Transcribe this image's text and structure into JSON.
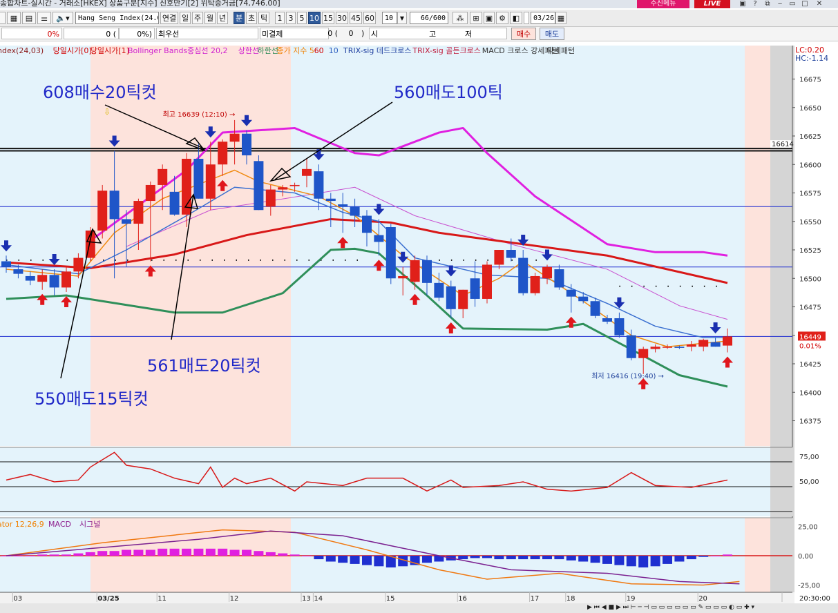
{
  "window": {
    "title_fragment": "종합차트-실시간 - 거래소[HKEX] 상품구분[지수] 신호만기[2] 위탁증거금[74,746.00]",
    "ad_badge": "수신메뉴",
    "live_badge": "LIVE"
  },
  "toolbar": {
    "symbol": "Hang Seng Index(24.0",
    "period_buttons": [
      "연결",
      "일",
      "주",
      "월",
      "년",
      "분",
      "초",
      "틱"
    ],
    "active_period": "분",
    "interval_buttons": [
      "1",
      "3",
      "5",
      "10",
      "15",
      "30",
      "45",
      "60"
    ],
    "active_interval": "10",
    "interval_select": "10",
    "bar_count": "66/600",
    "date_value": "03/26"
  },
  "info": {
    "change_pct": "0%",
    "vol": "0 (",
    "vol_pct": "0%)",
    "best_ask_label": "최우선",
    "oi_label": "미결제",
    "oi_value": "0 (",
    "oi_change": "0",
    "oi_close": ")",
    "ohlc_labels": [
      "시",
      "고",
      "저"
    ],
    "buy_btn": "매수",
    "sell_btn": "매도"
  },
  "legend": [
    {
      "text": "ndex(24,03)",
      "color": "#8b1a1a"
    },
    {
      "text": "당일시가[0]",
      "color": "#d10000"
    },
    {
      "text": "당일시가[1]",
      "color": "#d10000"
    },
    {
      "text": "Bollinger Bands중심선 20,2",
      "color": "#d020d0"
    },
    {
      "text": "상한선",
      "color": "#d020d0"
    },
    {
      "text": "하한선",
      "color": "#2e8b57"
    },
    {
      "text": "종가 지수 5",
      "color": "#f08000"
    },
    {
      "text": "60",
      "color": "#d10000"
    },
    {
      "text": "10",
      "color": "#3060c0"
    },
    {
      "text": "TRIX-sig 데드크로스",
      "color": "#2040a0"
    },
    {
      "text": "TRIX-sig 골든크로스",
      "color": "#c02040"
    },
    {
      "text": "MACD 크로스 강세패턴",
      "color": "#333333"
    },
    {
      "text": "약세패턴",
      "color": "#333333"
    }
  ],
  "right_corner": {
    "lc": "LC:0.20",
    "hc": "HC:-1.14"
  },
  "colors": {
    "up": "#e0201a",
    "down": "#1f55c8",
    "bb_band": "#e020e0",
    "bb_lower": "#2f8f5a",
    "ma60": "#d81818",
    "ma10": "#3a6fd0",
    "ema5": "#f08a10",
    "session_bg": "#fde3dc",
    "chart_bg": "#e4f3fb"
  },
  "chart_data": {
    "type": "candlestick",
    "symbol": "Hang Seng Index",
    "ylim": [
      16365,
      16685
    ],
    "y_ticks": [
      16675,
      16650,
      16625,
      16600,
      16575,
      16550,
      16525,
      16500,
      16475,
      16450,
      16425,
      16400,
      16375
    ],
    "x_labels": [
      {
        "bar": 1,
        "label": "03"
      },
      {
        "bar": 8,
        "label": "03/25"
      },
      {
        "bar": 13,
        "label": "11"
      },
      {
        "bar": 19,
        "label": "12"
      },
      {
        "bar": 25,
        "label": "13"
      },
      {
        "bar": 26,
        "label": "14"
      },
      {
        "bar": 32,
        "label": "15"
      },
      {
        "bar": 38,
        "label": "16"
      },
      {
        "bar": 44,
        "label": "17"
      },
      {
        "bar": 47,
        "label": "18"
      },
      {
        "bar": 52,
        "label": "19"
      },
      {
        "bar": 58,
        "label": "20"
      },
      {
        "bar": 65,
        "label": "20:30:00"
      }
    ],
    "candles": [
      [
        16515,
        16520,
        16505,
        16510
      ],
      [
        16508,
        16512,
        16500,
        16504
      ],
      [
        16502,
        16506,
        16494,
        16498
      ],
      [
        16497,
        16508,
        16490,
        16503
      ],
      [
        16503,
        16508,
        16485,
        16492
      ],
      [
        16492,
        16510,
        16488,
        16506
      ],
      [
        16506,
        16522,
        16500,
        16518
      ],
      [
        16518,
        16545,
        16515,
        16542
      ],
      [
        16542,
        16582,
        16535,
        16577
      ],
      [
        16577,
        16612,
        16500,
        16552
      ],
      [
        16552,
        16560,
        16510,
        16548
      ],
      [
        16548,
        16570,
        16525,
        16568
      ],
      [
        16568,
        16585,
        16515,
        16582
      ],
      [
        16582,
        16600,
        16560,
        16596
      ],
      [
        16576,
        16590,
        16555,
        16556
      ],
      [
        16556,
        16610,
        16545,
        16605
      ],
      [
        16605,
        16618,
        16570,
        16570
      ],
      [
        16570,
        16620,
        16560,
        16600
      ],
      [
        16600,
        16622,
        16590,
        16620
      ],
      [
        16620,
        16639,
        16600,
        16627
      ],
      [
        16627,
        16630,
        16600,
        16608
      ],
      [
        16603,
        16608,
        16560,
        16560
      ],
      [
        16563,
        16582,
        16555,
        16578
      ],
      [
        16578,
        16582,
        16572,
        16580
      ],
      [
        16581,
        16584,
        16576,
        16582
      ],
      [
        16590,
        16605,
        16580,
        16596
      ],
      [
        16594,
        16600,
        16560,
        16570
      ],
      [
        16570,
        16575,
        16545,
        16568
      ],
      [
        16565,
        16575,
        16540,
        16563
      ],
      [
        16563,
        16570,
        16545,
        16555
      ],
      [
        16555,
        16560,
        16528,
        16540
      ],
      [
        16538,
        16552,
        16520,
        16532
      ],
      [
        16545,
        16548,
        16495,
        16500
      ],
      [
        16500,
        16510,
        16485,
        16502
      ],
      [
        16497,
        16520,
        16490,
        16516
      ],
      [
        16516,
        16520,
        16485,
        16496
      ],
      [
        16496,
        16505,
        16480,
        16483
      ],
      [
        16493,
        16498,
        16465,
        16473
      ],
      [
        16473,
        16490,
        16465,
        16490
      ],
      [
        16500,
        16515,
        16475,
        16482
      ],
      [
        16482,
        16515,
        16478,
        16512
      ],
      [
        16512,
        16525,
        16508,
        16525
      ],
      [
        16525,
        16535,
        16515,
        16518
      ],
      [
        16518,
        16525,
        16485,
        16487
      ],
      [
        16487,
        16505,
        16485,
        16502
      ],
      [
        16500,
        16512,
        16495,
        16510
      ],
      [
        16508,
        16512,
        16490,
        16492
      ],
      [
        16490,
        16495,
        16470,
        16484
      ],
      [
        16484,
        16488,
        16478,
        16480
      ],
      [
        16480,
        16483,
        16465,
        16467
      ],
      [
        16465,
        16468,
        16460,
        16462
      ],
      [
        16465,
        16470,
        16448,
        16450
      ],
      [
        16450,
        16455,
        16428,
        16430
      ],
      [
        16430,
        16440,
        16416,
        16438
      ],
      [
        16438,
        16442,
        16435,
        16440
      ],
      [
        16440,
        16442,
        16438,
        16440
      ],
      [
        16440,
        16441,
        16438,
        16439
      ],
      [
        16440,
        16445,
        16436,
        16442
      ],
      [
        16440,
        16447,
        16436,
        16446
      ],
      [
        16444,
        16448,
        16440,
        16440
      ],
      [
        16441,
        16456,
        16435,
        16449
      ]
    ],
    "bb_upper": [
      [
        7,
        16533
      ],
      [
        15,
        16595
      ],
      [
        18,
        16628
      ],
      [
        24,
        16632
      ],
      [
        29,
        16610
      ],
      [
        31,
        16608
      ],
      [
        36,
        16628
      ],
      [
        38,
        16632
      ],
      [
        40,
        16610
      ],
      [
        44,
        16572
      ],
      [
        50,
        16530
      ],
      [
        54,
        16523
      ],
      [
        58,
        16523
      ],
      [
        60,
        16520
      ]
    ],
    "bb_lower": [
      [
        0,
        16482
      ],
      [
        5,
        16485
      ],
      [
        8,
        16480
      ],
      [
        14,
        16470
      ],
      [
        18,
        16470
      ],
      [
        23,
        16487
      ],
      [
        27,
        16525
      ],
      [
        29,
        16526
      ],
      [
        31,
        16522
      ],
      [
        35,
        16485
      ],
      [
        38,
        16456
      ],
      [
        45,
        16455
      ],
      [
        48,
        16460
      ],
      [
        53,
        16432
      ],
      [
        56,
        16415
      ],
      [
        60,
        16405
      ]
    ],
    "ma60": [
      [
        0,
        16514
      ],
      [
        7,
        16509
      ],
      [
        14,
        16521
      ],
      [
        20,
        16538
      ],
      [
        27,
        16552
      ],
      [
        32,
        16549
      ],
      [
        36,
        16540
      ],
      [
        43,
        16530
      ],
      [
        50,
        16520
      ],
      [
        60,
        16496
      ]
    ],
    "ma10": [
      [
        0,
        16512
      ],
      [
        6,
        16504
      ],
      [
        10,
        16525
      ],
      [
        15,
        16555
      ],
      [
        19,
        16580
      ],
      [
        24,
        16575
      ],
      [
        28,
        16558
      ],
      [
        31,
        16550
      ],
      [
        34,
        16518
      ],
      [
        40,
        16503
      ],
      [
        45,
        16500
      ],
      [
        50,
        16478
      ],
      [
        54,
        16458
      ],
      [
        58,
        16448
      ],
      [
        60,
        16448
      ]
    ],
    "ema5": [
      [
        0,
        16508
      ],
      [
        6,
        16502
      ],
      [
        9,
        16540
      ],
      [
        13,
        16570
      ],
      [
        19,
        16595
      ],
      [
        21,
        16585
      ],
      [
        26,
        16572
      ],
      [
        29,
        16555
      ],
      [
        33,
        16520
      ],
      [
        38,
        16485
      ],
      [
        41,
        16500
      ],
      [
        43,
        16515
      ],
      [
        48,
        16480
      ],
      [
        52,
        16450
      ],
      [
        55,
        16440
      ],
      [
        60,
        16445
      ]
    ],
    "bb_mid": [
      [
        10,
        16528
      ],
      [
        17,
        16560
      ],
      [
        22,
        16568
      ],
      [
        29,
        16580
      ],
      [
        34,
        16555
      ],
      [
        42,
        16530
      ],
      [
        50,
        16508
      ],
      [
        56,
        16476
      ],
      [
        60,
        16464
      ]
    ],
    "hlines": [
      {
        "y": 16614,
        "label": "16614",
        "thick": true
      },
      {
        "y": 16612,
        "label": "",
        "thick": true
      },
      {
        "y": 16563,
        "label": "",
        "thick": false
      },
      {
        "y": 16510,
        "label": "",
        "thick": false
      },
      {
        "y": 16449,
        "label": "",
        "thick": false
      }
    ],
    "dotted_levels": [
      {
        "y": 16516,
        "from": 0,
        "to": 30
      },
      {
        "y": 16493,
        "from": 51,
        "to": 60
      },
      {
        "y": 16516,
        "from": 36,
        "to": 45
      }
    ],
    "buy_signals": [
      3,
      5,
      12,
      18,
      28,
      31,
      34,
      37,
      47,
      53,
      60
    ],
    "sell_signals": [
      0,
      4,
      9,
      17,
      20,
      26,
      31,
      33,
      37,
      43,
      45,
      51,
      59
    ],
    "max_label": {
      "text": "최고 16639 (12:10) →",
      "bar": 19,
      "price": 16639
    },
    "min_label": {
      "text": "최저 16416 (19:40) →",
      "bar": 53,
      "price": 16416
    },
    "last_price": "16449",
    "last_change": "0.01%",
    "annotations": [
      {
        "text": "608매수20틱컷"
      },
      {
        "text": "560매도100틱"
      },
      {
        "text": "561매도20틱컷"
      },
      {
        "text": "550매도15틱컷"
      }
    ],
    "rsi": {
      "ticks": [
        "75,00",
        "50,00"
      ],
      "series": [
        [
          0,
          16
        ],
        [
          2,
          19
        ],
        [
          4,
          15
        ],
        [
          6,
          16
        ],
        [
          7,
          23
        ],
        [
          9,
          31
        ],
        [
          10,
          24
        ],
        [
          12,
          22
        ],
        [
          14,
          17
        ],
        [
          16,
          14
        ],
        [
          17,
          23
        ],
        [
          18,
          12
        ],
        [
          19,
          17
        ],
        [
          20,
          14
        ],
        [
          22,
          17
        ],
        [
          24,
          10
        ],
        [
          25,
          15
        ],
        [
          28,
          13
        ],
        [
          30,
          17
        ],
        [
          33,
          17
        ],
        [
          35,
          10
        ],
        [
          37,
          16
        ],
        [
          38,
          12
        ],
        [
          41,
          13
        ],
        [
          43,
          15
        ],
        [
          45,
          11
        ],
        [
          47,
          10
        ],
        [
          50,
          12
        ],
        [
          52,
          20
        ],
        [
          54,
          13
        ],
        [
          57,
          12
        ],
        [
          60,
          16
        ]
      ]
    },
    "macd": {
      "label_prefix": "ator 12,26,9",
      "macd_label": "MACD",
      "signal_label": "시그널",
      "ticks": [
        "25,00",
        "0,00",
        "-25,00"
      ],
      "macd_line": [
        [
          0,
          0
        ],
        [
          8,
          11
        ],
        [
          18,
          22
        ],
        [
          24,
          20
        ],
        [
          30,
          5
        ],
        [
          36,
          -12
        ],
        [
          40,
          -20
        ],
        [
          46,
          -15
        ],
        [
          52,
          -24
        ],
        [
          58,
          -25
        ],
        [
          61,
          -22
        ]
      ],
      "signal_line": [
        [
          0,
          0
        ],
        [
          8,
          7
        ],
        [
          16,
          14
        ],
        [
          22,
          21
        ],
        [
          28,
          17
        ],
        [
          36,
          0
        ],
        [
          42,
          -12
        ],
        [
          50,
          -15
        ],
        [
          56,
          -22
        ],
        [
          61,
          -24
        ]
      ],
      "histogram": [
        0,
        0,
        0,
        1,
        1,
        1,
        2,
        3,
        4,
        4,
        5,
        5,
        5,
        6,
        6,
        6,
        6,
        6,
        6,
        5,
        5,
        4,
        3,
        2,
        1,
        0,
        -3,
        -5,
        -6,
        -7,
        -8,
        -9,
        -10,
        -9,
        -8,
        -6,
        -5,
        -4,
        -3,
        -2,
        -2,
        -3,
        -3,
        -3,
        -3,
        -3,
        -3,
        -4,
        -5,
        -6,
        -7,
        -8,
        -9,
        -10,
        -9,
        -7,
        -5,
        -3,
        -1,
        0,
        1
      ]
    }
  }
}
